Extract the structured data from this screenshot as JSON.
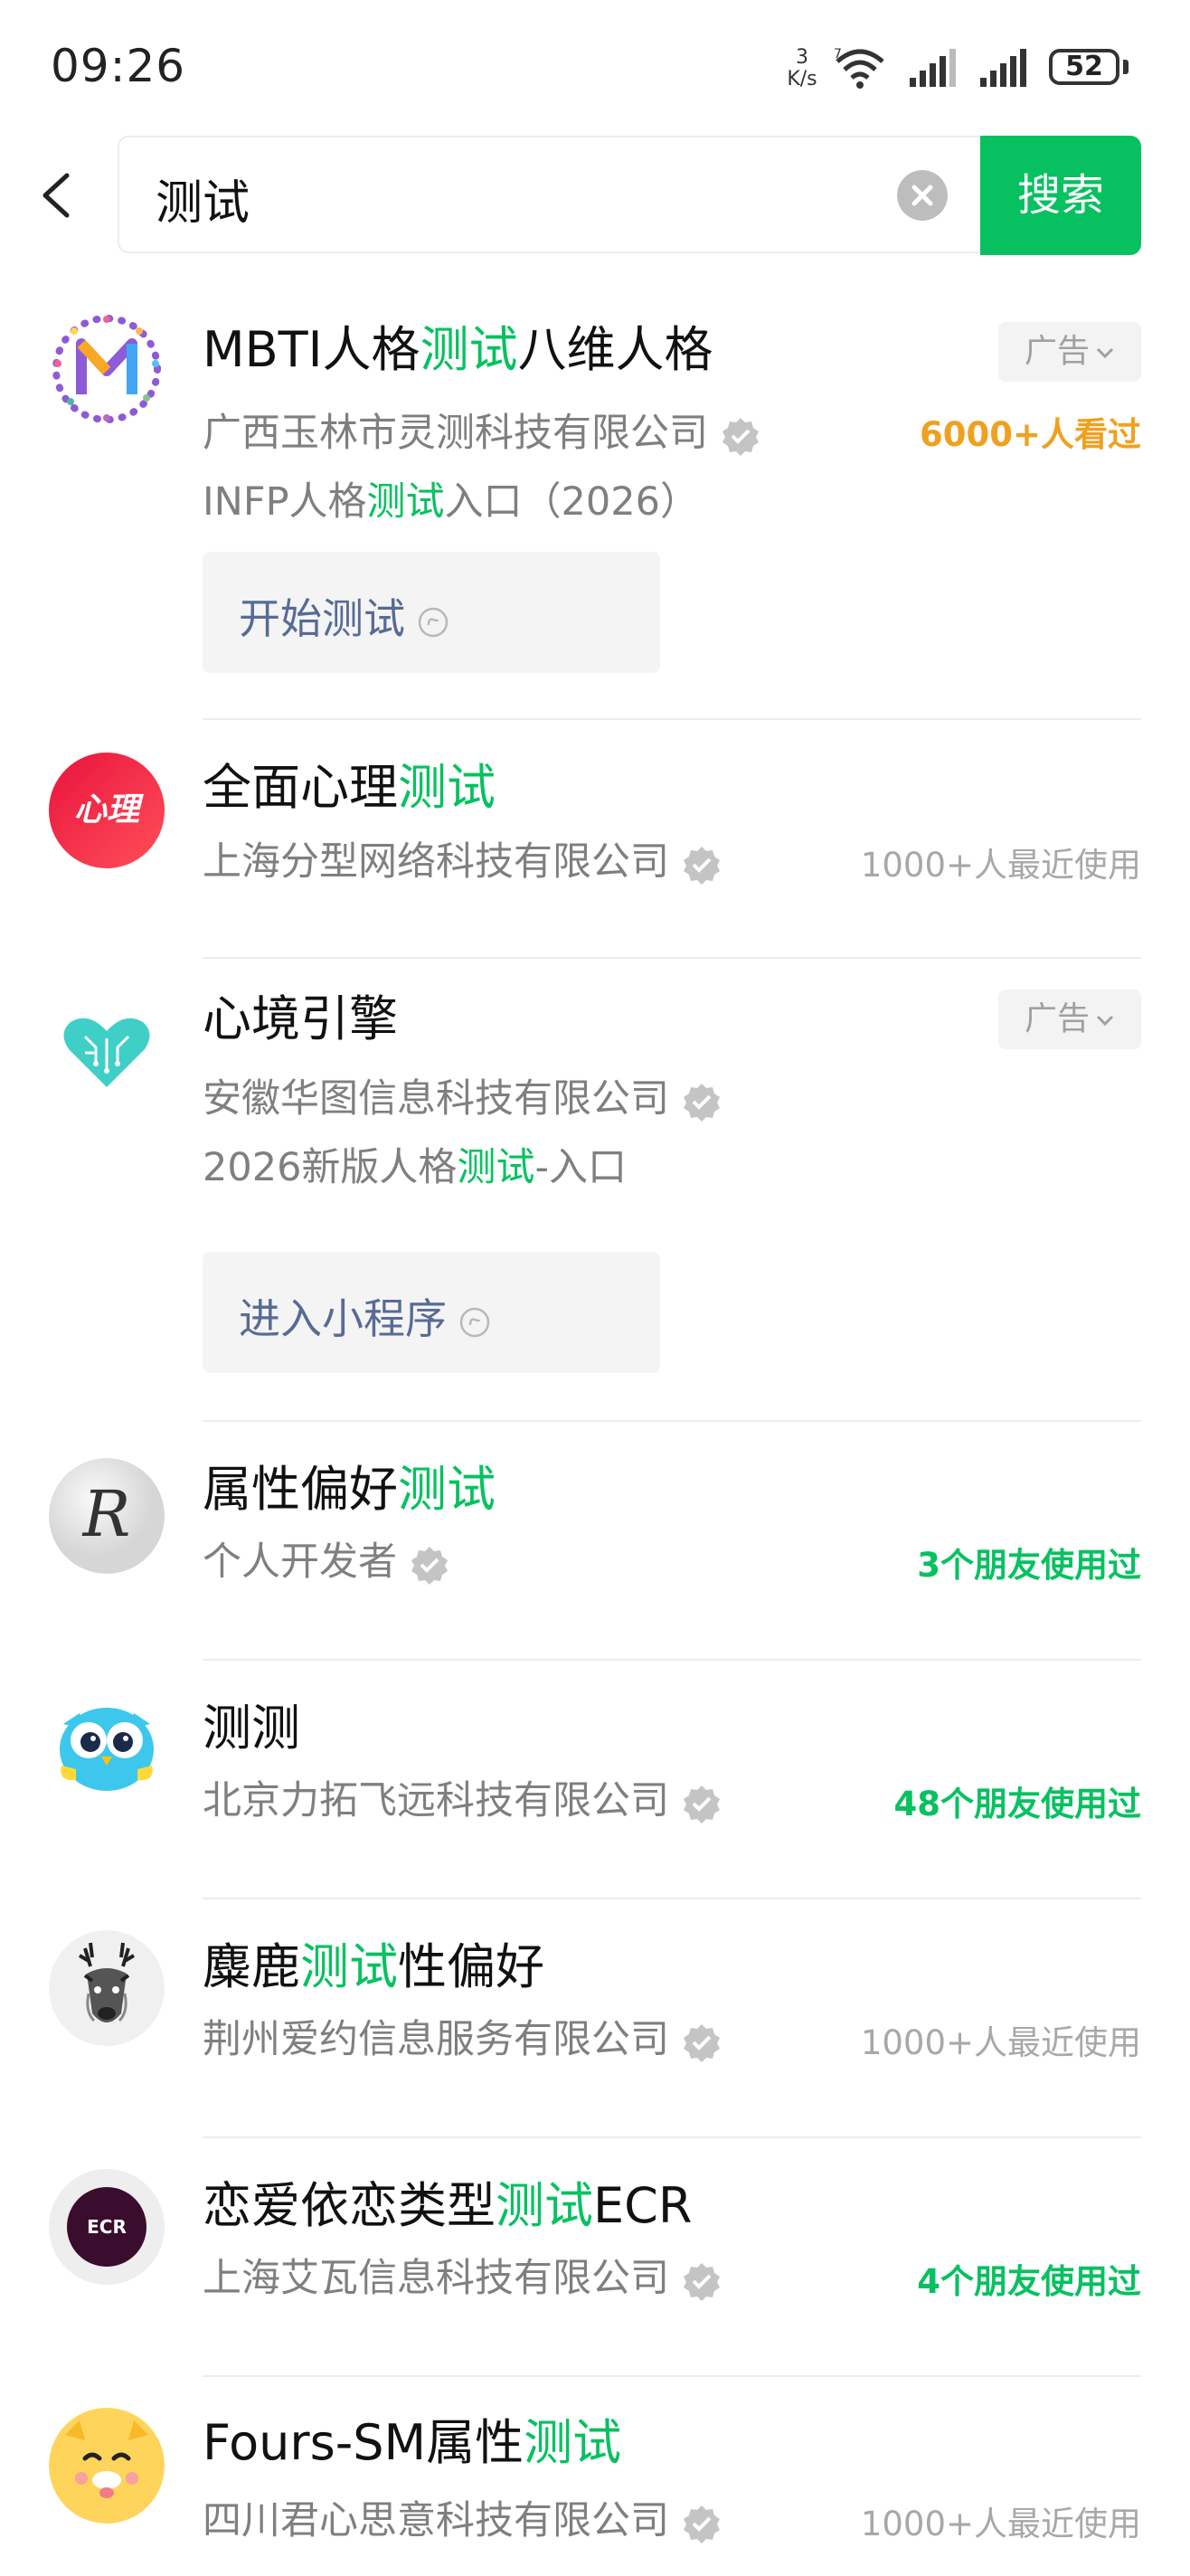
{
  "status_bar": {
    "time": "09:26",
    "net_speed_value": "3",
    "net_speed_unit": "K/s",
    "battery": "52"
  },
  "search": {
    "query": "测试",
    "button_label": "搜索"
  },
  "results": [
    {
      "title_parts": [
        "MBTI人格",
        "测试",
        "八维人格"
      ],
      "company": "广西玉林市灵测科技有限公司",
      "description_parts": [
        "INFP人格",
        "测试",
        "入口（2026）"
      ],
      "badge": "广告",
      "meta": "6000+人看过",
      "action": "开始测试"
    },
    {
      "title_parts": [
        "全面心理",
        "测试",
        ""
      ],
      "company": "上海分型网络科技有限公司",
      "meta": "1000+人最近使用",
      "avatar_text": "心理"
    },
    {
      "title_parts": [
        "心境引擎",
        "",
        ""
      ],
      "company": "安徽华图信息科技有限公司",
      "description_parts": [
        "2026新版人格",
        "测试",
        "-入口"
      ],
      "badge": "广告",
      "action": "进入小程序"
    },
    {
      "title_parts": [
        "属性偏好",
        "测试",
        ""
      ],
      "company": "个人开发者",
      "meta": "3个朋友使用过"
    },
    {
      "title_parts": [
        "测测",
        "",
        ""
      ],
      "company": "北京力拓飞远科技有限公司",
      "meta": "48个朋友使用过"
    },
    {
      "title_parts": [
        "麋鹿",
        "测试",
        "性偏好"
      ],
      "company": "荆州爱约信息服务有限公司",
      "meta": "1000+人最近使用"
    },
    {
      "title_parts": [
        "恋爱依恋类型",
        "测试",
        "ECR"
      ],
      "company": "上海艾瓦信息科技有限公司",
      "meta": "4个朋友使用过",
      "avatar_text": "ECR"
    },
    {
      "title_parts": [
        "Fours-SM属性",
        "测试",
        ""
      ],
      "company": "四川君心思意科技有限公司",
      "meta": "1000+人最近使用"
    }
  ],
  "colors": {
    "accent_green": "#07c160",
    "link_blue": "#576b95",
    "orange": "#f0a020"
  }
}
